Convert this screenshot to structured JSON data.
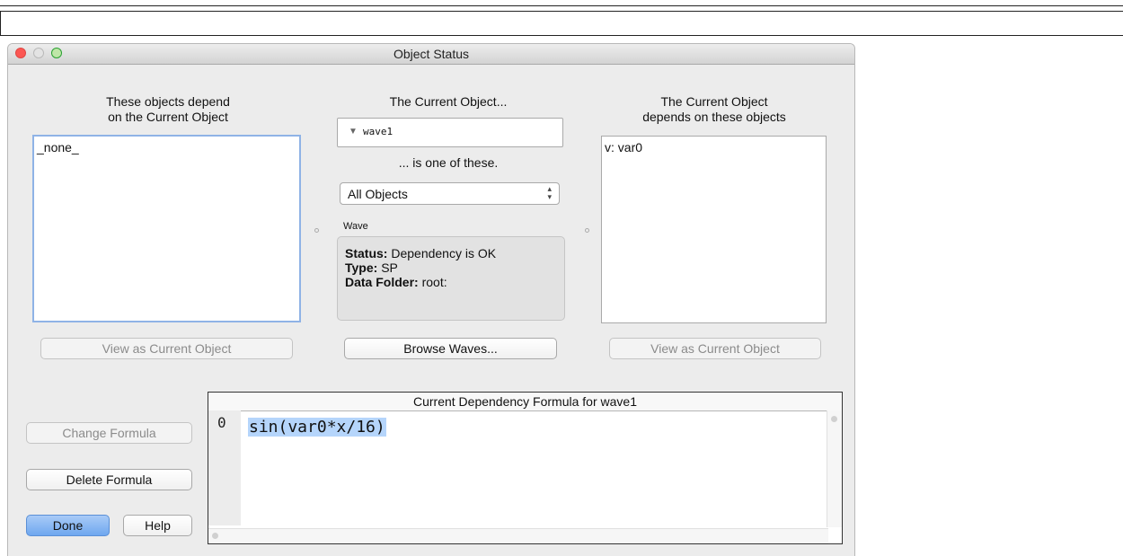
{
  "window": {
    "title": "Object Status"
  },
  "left": {
    "heading_line1": "These objects depend",
    "heading_line2": "on the Current Object",
    "items": [
      "_none_"
    ],
    "view_button": "View as Current Object"
  },
  "center": {
    "heading": "The Current Object...",
    "current_object": "wave1",
    "is_one_of": "... is one of these.",
    "filter_popup": "All Objects",
    "type_label": "Wave",
    "status_label": "Status:",
    "status_value": "Dependency is OK",
    "type_label2": "Type:",
    "type_value": "SP",
    "folder_label": "Data Folder:",
    "folder_value": "root:",
    "browse_button": "Browse Waves..."
  },
  "right": {
    "heading_line1": "The Current Object",
    "heading_line2": "depends on these objects",
    "items": [
      "v: var0"
    ],
    "view_button": "View as Current Object"
  },
  "formula": {
    "title": "Current Dependency Formula for wave1",
    "line_number": "0",
    "code": "sin(var0*x/16)"
  },
  "buttons": {
    "change_formula": "Change Formula",
    "delete_formula": "Delete Formula",
    "done": "Done",
    "help": "Help"
  }
}
